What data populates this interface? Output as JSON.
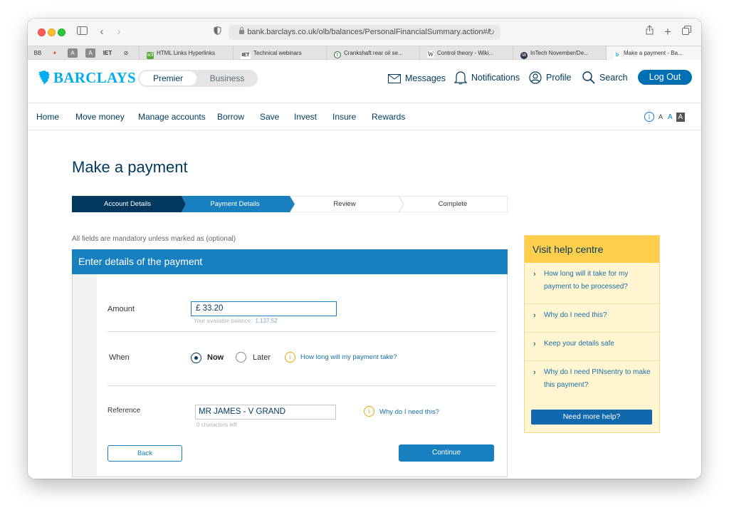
{
  "browser": {
    "url": "bank.barclays.co.uk/olb/balances/PersonalFinancialSummary.action#/",
    "pinned_tabs": [
      "BB",
      "✦",
      "A",
      "A",
      "IET",
      "⊘"
    ],
    "tabs": [
      {
        "label": "HTML Links Hyperlinks",
        "icon": "w3"
      },
      {
        "label": "Technical webinars",
        "icon": "IET"
      },
      {
        "label": "Crankshaft rear oil se...",
        "icon": "t"
      },
      {
        "label": "Control theory - Wiki...",
        "icon": "W"
      },
      {
        "label": "InTech November/De...",
        "icon": "ia"
      },
      {
        "label": "Make a payment - Ba...",
        "icon": "b"
      }
    ]
  },
  "header": {
    "brand": "BARCLAYS",
    "toggle": {
      "premier": "Premier",
      "business": "Business"
    },
    "messages": "Messages",
    "notifications": "Notifications",
    "profile": "Profile",
    "search": "Search",
    "logout": "Log Out"
  },
  "nav": {
    "items": [
      "Home",
      "Move money",
      "Manage accounts",
      "Borrow",
      "Save",
      "Invest",
      "Insure",
      "Rewards"
    ],
    "font_sizes": [
      "A",
      "A",
      "A"
    ]
  },
  "page": {
    "title": "Make a payment",
    "steps": [
      "Account Details",
      "Payment Details",
      "Review",
      "Complete"
    ],
    "current_step": 2,
    "mandatory_note": "All fields are mandatory unless marked as (optional)"
  },
  "form": {
    "heading": "Enter details of the payment",
    "amount_label": "Amount",
    "amount_value": "£  33.20",
    "balance_label": "Your available balance:",
    "balance_value": "1,137.52",
    "when_label": "When",
    "when_now": "Now",
    "when_later": "Later",
    "when_selected": "Now",
    "when_link": "How long will my payment take?",
    "reference_label": "Reference",
    "reference_value": "MR JAMES - V GRAND",
    "reference_hint": "0 characters left",
    "reference_link": "Why do I need this?",
    "back": "Back",
    "continue": "Continue"
  },
  "help": {
    "title": "Visit help centre",
    "items": [
      "How long will it take for my payment to be processed?",
      "Why do I need this?",
      "Keep your details safe",
      "Why do I need PINsentry to make this payment?"
    ],
    "button": "Need more help?"
  },
  "colors": {
    "brand": "#00aeef",
    "navy": "#00395d",
    "primary": "#1880bf",
    "help_bg": "#fff6d1",
    "help_head": "#ffcf4b"
  }
}
